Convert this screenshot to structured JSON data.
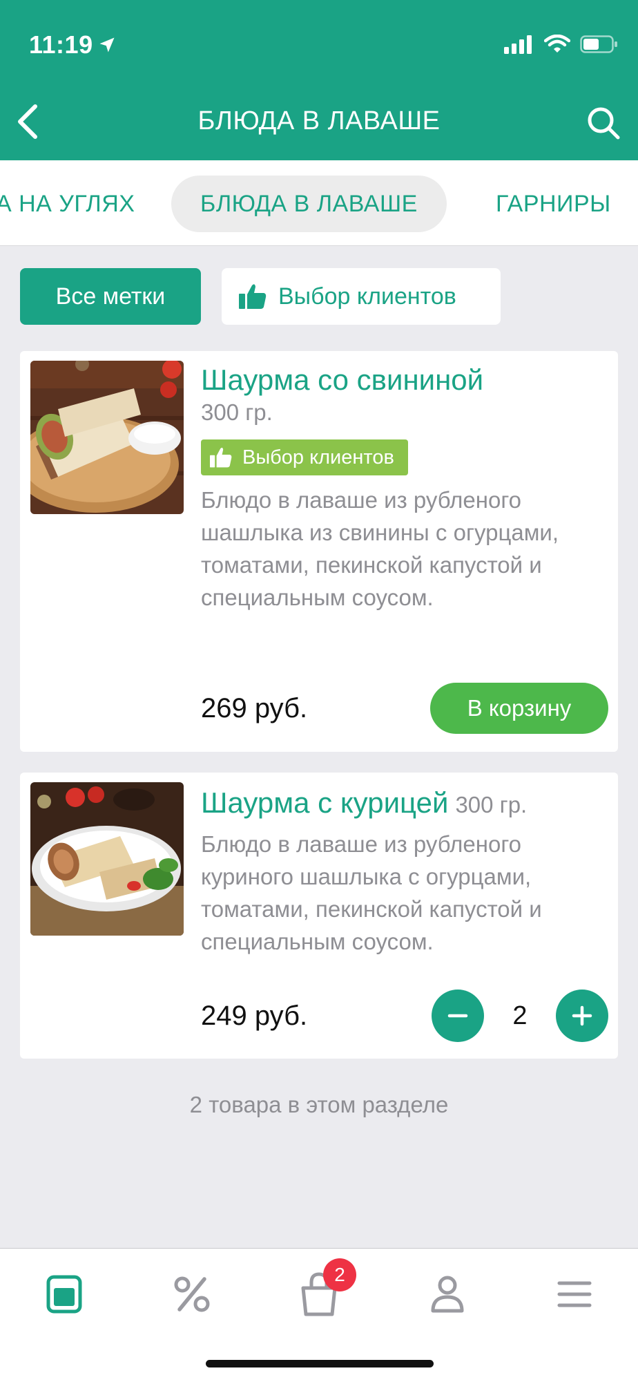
{
  "status_bar": {
    "time": "11:19"
  },
  "nav": {
    "title": "БЛЮДА В ЛАВАШЕ"
  },
  "categories": [
    {
      "label": "А НА УГЛЯХ"
    },
    {
      "label": "БЛЮДА В ЛАВАШЕ",
      "active": true
    },
    {
      "label": "ГАРНИРЫ"
    }
  ],
  "filters": {
    "all_tags": "Все метки",
    "customer_choice": "Выбор клиентов"
  },
  "products": [
    {
      "title": "Шаурма со свининой",
      "weight": "300 гр.",
      "badge": "Выбор клиентов",
      "description": "Блюдо в лаваше из рубленого шашлыка из свинины с огурцами, томатами, пекинской капустой и специальным соусом.",
      "price": "269 руб.",
      "action": "В корзину"
    },
    {
      "title": "Шаурма с курицей",
      "weight": "300 гр.",
      "description": "Блюдо в лаваше из рубленого куриного шашлыка с огурцами, томатами, пекинской капустой и специальным соусом.",
      "price": "249 руб.",
      "quantity": "2"
    }
  ],
  "section_count": "2 товара в этом разделе",
  "tabbar": {
    "cart_badge": "2"
  },
  "colors": {
    "primary": "#1aa385",
    "cart_button": "#4db84b",
    "badge": "#8bc34a",
    "notification": "#ee3244"
  },
  "icons": [
    "location-arrow-icon",
    "signal-icon",
    "wifi-icon",
    "battery-icon",
    "back-arrow-icon",
    "search-icon",
    "thumbs-up-icon",
    "minus-icon",
    "plus-icon",
    "menu-catalog-icon",
    "percent-icon",
    "cart-bag-icon",
    "profile-icon",
    "hamburger-menu-icon"
  ]
}
